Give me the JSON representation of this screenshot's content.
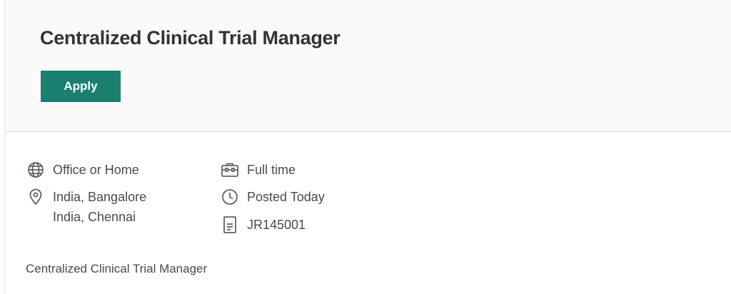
{
  "job": {
    "title": "Centralized Clinical Trial Manager",
    "apply_label": "Apply",
    "description": "Centralized Clinical Trial Manager"
  },
  "meta": {
    "workplace": {
      "icon": "globe-icon",
      "text": "Office or Home"
    },
    "locations": {
      "icon": "map-pin-icon",
      "lines": [
        "India, Bangalore",
        "India, Chennai"
      ]
    },
    "time_type": {
      "icon": "briefcase-icon",
      "text": "Full time"
    },
    "posted": {
      "icon": "clock-icon",
      "text": "Posted Today"
    },
    "requisition": {
      "icon": "document-icon",
      "text": "JR145001"
    }
  },
  "colors": {
    "accent": "#1a7f6e",
    "header_bg": "#fafafa",
    "icon": "#5f6368",
    "text": "#4a4a4a"
  }
}
